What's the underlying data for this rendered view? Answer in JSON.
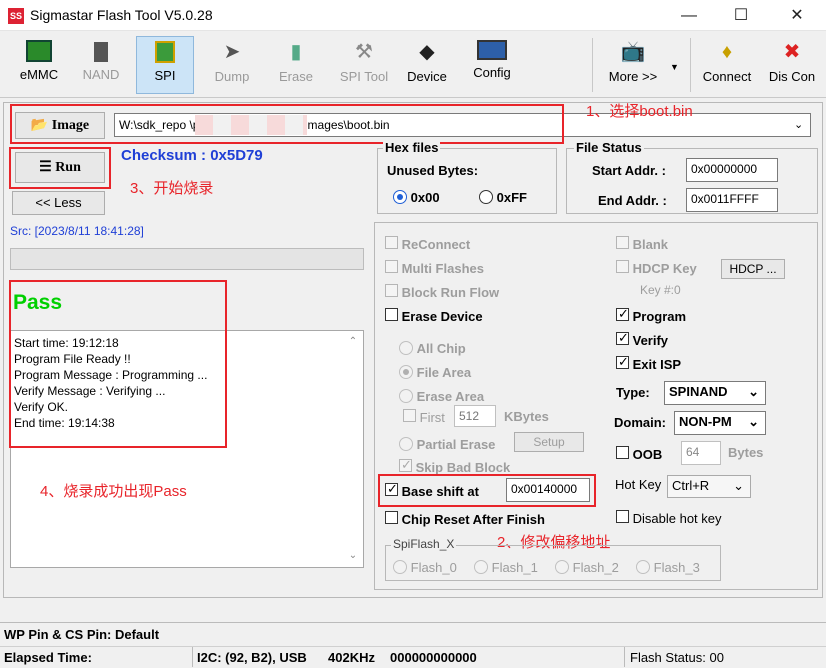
{
  "window": {
    "title": "Sigmastar Flash Tool V5.0.28",
    "app_icon": "SS"
  },
  "toolbar": {
    "items": [
      {
        "label": "eMMC",
        "icon": "chip-icon"
      },
      {
        "label": "NAND",
        "icon": "nand-chip-icon"
      },
      {
        "label": "SPI",
        "icon": "spi-icon"
      },
      {
        "label": "Dump",
        "icon": "dump-icon"
      },
      {
        "label": "Erase",
        "icon": "eraser-icon"
      },
      {
        "label": "SPI Tool",
        "icon": "tool-icon"
      },
      {
        "label": "Device",
        "icon": "device-icon"
      },
      {
        "label": "Config",
        "icon": "config-icon"
      },
      {
        "label": "More >>",
        "icon": "tv-icon"
      },
      {
        "label": "Connect",
        "icon": "connect-icon"
      },
      {
        "label": "Dis Con",
        "icon": "disconnect-icon"
      }
    ]
  },
  "image": {
    "button_label": "Image",
    "path": "W:\\sdk_repo                        \\project\\image\\output\\images\\boot.bin"
  },
  "run": {
    "button_label": "Run",
    "checksum": "Checksum : 0x5D79",
    "less_label": "<< Less"
  },
  "hex_files": {
    "title": "Hex files",
    "unused_label": "Unused Bytes:",
    "opt1": "0x00",
    "opt2": "0xFF"
  },
  "file_status": {
    "title": "File Status",
    "start_label": "Start Addr. :",
    "start_value": "0x00000000",
    "end_label": "End Addr. :",
    "end_value": "0x0011FFFF"
  },
  "src_line": "Src: [2023/8/11 18:41:28]",
  "result": "Pass",
  "log": [
    "Start time: 19:12:18",
    "Program File Ready !!",
    "Program Message : Programming ...",
    "Verify Message : Verifying ...",
    "Verify OK.",
    "End time: 19:14:38"
  ],
  "options": {
    "reconnect": "ReConnect",
    "multi_flashes": "Multi Flashes",
    "block_run_flow": "Block Run Flow",
    "erase_device": "Erase Device",
    "all_chip": "All Chip",
    "file_area": "File Area",
    "erase_area": "Erase Area",
    "first_label": "First",
    "first_value": "512",
    "kbytes": "KBytes",
    "partial_erase": "Partial Erase",
    "setup": "Setup",
    "skip_bad_block": "Skip Bad Block",
    "base_shift": "Base shift at",
    "base_shift_value": "0x00140000",
    "chip_reset": "Chip Reset After Finish",
    "spiflash_title": "SpiFlash_X",
    "flash_items": [
      "Flash_0",
      "Flash_1",
      "Flash_2",
      "Flash_3"
    ]
  },
  "right_opts": {
    "blank": "Blank",
    "hdcp_key": "HDCP Key",
    "hdcp_btn": "HDCP ...",
    "key_label": "Key #:0",
    "program": "Program",
    "verify": "Verify",
    "exit_isp": "Exit ISP",
    "type_label": "Type:",
    "type_value": "SPINAND",
    "domain_label": "Domain:",
    "domain_value": "NON-PM",
    "oob_label": "OOB",
    "oob_value": "64",
    "bytes": "Bytes",
    "hotkey_label": "Hot Key",
    "hotkey_value": "Ctrl+R",
    "disable_hotkey": "Disable hot key"
  },
  "annotations": {
    "a1": "1、选择boot.bin",
    "a2": "2、修改偏移地址",
    "a3": "3、开始烧录",
    "a4": "4、烧录成功出现Pass"
  },
  "status": {
    "wp_pin": "WP Pin & CS Pin: Default",
    "elapsed": "Elapsed Time:",
    "i2c": "I2C: (92, B2), USB",
    "khz": "402KHz",
    "counter": "000000000000",
    "flash_status": "Flash Status: 00"
  },
  "colors": {
    "accent_blue": "#1f3fd6",
    "pass_green": "#00d000",
    "annotation_red": "#e8242a"
  }
}
